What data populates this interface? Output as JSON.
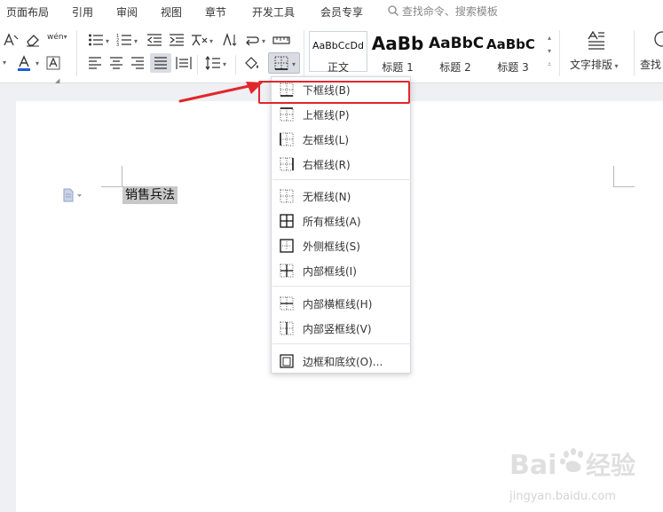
{
  "tabs": {
    "items": [
      "页面布局",
      "引用",
      "审阅",
      "视图",
      "章节",
      "开发工具",
      "会员专享"
    ],
    "search_placeholder": "查找命令、搜索模板"
  },
  "toolbar": {
    "pinyin_glyph": "wén",
    "styles": [
      {
        "sample": "AaBbCcDd",
        "label": "正文"
      },
      {
        "sample": "AaBb",
        "label": "标题 1"
      },
      {
        "sample": "AaBbC",
        "label": "标题 2"
      },
      {
        "sample": "AaBbC",
        "label": "标题 3"
      }
    ],
    "text_layout_label": "文字排版",
    "find_label": "查找"
  },
  "document": {
    "selected_text": "销售兵法"
  },
  "border_menu": {
    "items": [
      {
        "label": "下框线(B)",
        "icon": "bottom-border-icon"
      },
      {
        "label": "上框线(P)",
        "icon": "top-border-icon"
      },
      {
        "label": "左框线(L)",
        "icon": "left-border-icon"
      },
      {
        "label": "右框线(R)",
        "icon": "right-border-icon"
      },
      {
        "label": "无框线(N)",
        "icon": "no-border-icon"
      },
      {
        "label": "所有框线(A)",
        "icon": "all-borders-icon"
      },
      {
        "label": "外侧框线(S)",
        "icon": "outside-borders-icon"
      },
      {
        "label": "内部框线(I)",
        "icon": "inside-borders-icon"
      },
      {
        "label": "内部横框线(H)",
        "icon": "inside-horizontal-border-icon"
      },
      {
        "label": "内部竖框线(V)",
        "icon": "inside-vertical-border-icon"
      },
      {
        "label": "边框和底纹(O)...",
        "icon": "borders-shading-icon"
      }
    ]
  },
  "watermark": {
    "brand": "Baidu经验",
    "url": "jingyan.baidu.com"
  },
  "colors": {
    "accent_red": "#e3262a",
    "highlight": "#c8c8c8",
    "font_color_bar": "#1f5cd6"
  }
}
